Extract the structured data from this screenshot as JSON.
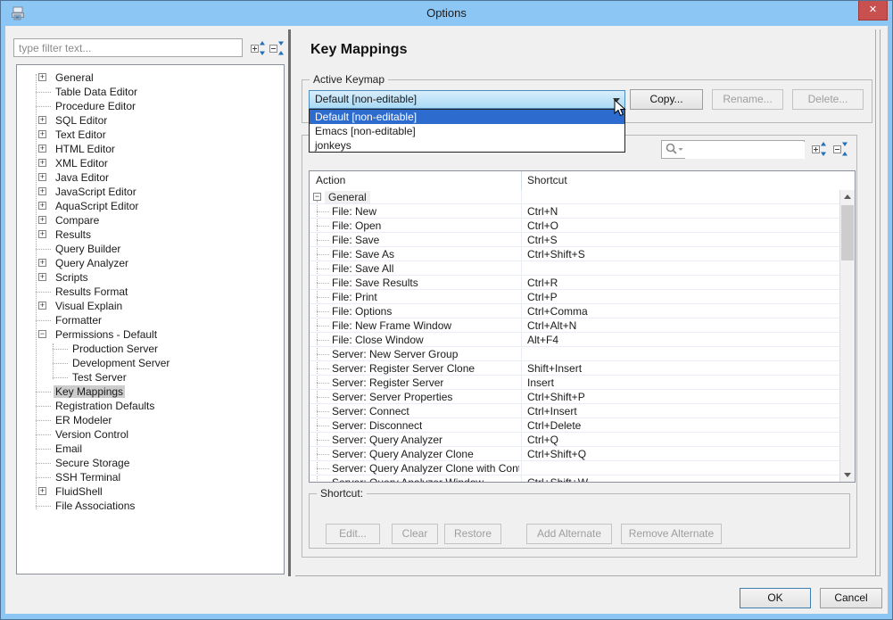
{
  "window": {
    "title": "Options"
  },
  "icons": {
    "close": "✕",
    "expander_collapsed": "+",
    "expander_expanded": "−",
    "search": "magnifier-with-dropdown",
    "expand_all": "plus-box-blue-arrows",
    "collapse_all": "minus-box-blue-arrows"
  },
  "colors": {
    "titlebar": "#8cc6f5",
    "close_button": "#c8504e",
    "selection_blue": "#2d6bcf",
    "combo_focus_top": "#d9eefc",
    "combo_focus_bottom": "#a9d9f5",
    "tree_selection": "#cccccc",
    "panel_bg": "#f0f0f0"
  },
  "left_panel": {
    "filter_placeholder": "type filter text...",
    "tree": [
      {
        "label": "General",
        "expander": "plus",
        "level": 0
      },
      {
        "label": "Table Data Editor",
        "expander": "none",
        "level": 0
      },
      {
        "label": "Procedure Editor",
        "expander": "none",
        "level": 0
      },
      {
        "label": "SQL Editor",
        "expander": "plus",
        "level": 0
      },
      {
        "label": "Text Editor",
        "expander": "plus",
        "level": 0
      },
      {
        "label": "HTML Editor",
        "expander": "plus",
        "level": 0
      },
      {
        "label": "XML Editor",
        "expander": "plus",
        "level": 0
      },
      {
        "label": "Java Editor",
        "expander": "plus",
        "level": 0
      },
      {
        "label": "JavaScript Editor",
        "expander": "plus",
        "level": 0
      },
      {
        "label": "AquaScript Editor",
        "expander": "plus",
        "level": 0
      },
      {
        "label": "Compare",
        "expander": "plus",
        "level": 0
      },
      {
        "label": "Results",
        "expander": "plus",
        "level": 0
      },
      {
        "label": "Query Builder",
        "expander": "none",
        "level": 0
      },
      {
        "label": "Query Analyzer",
        "expander": "plus",
        "level": 0
      },
      {
        "label": "Scripts",
        "expander": "plus",
        "level": 0
      },
      {
        "label": "Results Format",
        "expander": "none",
        "level": 0
      },
      {
        "label": "Visual Explain",
        "expander": "plus",
        "level": 0
      },
      {
        "label": "Formatter",
        "expander": "none",
        "level": 0
      },
      {
        "label": "Permissions - Default",
        "expander": "minus",
        "level": 0
      },
      {
        "label": "Production Server",
        "expander": "none",
        "level": 1
      },
      {
        "label": "Development Server",
        "expander": "none",
        "level": 1
      },
      {
        "label": "Test Server",
        "expander": "none",
        "level": 1
      },
      {
        "label": "Key Mappings",
        "expander": "none",
        "level": 0,
        "selected": true
      },
      {
        "label": "Registration Defaults",
        "expander": "none",
        "level": 0
      },
      {
        "label": "ER Modeler",
        "expander": "none",
        "level": 0
      },
      {
        "label": "Version Control",
        "expander": "none",
        "level": 0
      },
      {
        "label": "Email",
        "expander": "none",
        "level": 0
      },
      {
        "label": "Secure Storage",
        "expander": "none",
        "level": 0
      },
      {
        "label": "SSH Terminal",
        "expander": "none",
        "level": 0
      },
      {
        "label": "FluidShell",
        "expander": "plus",
        "level": 0
      },
      {
        "label": "File Associations",
        "expander": "none",
        "level": 0
      }
    ]
  },
  "right_panel": {
    "title": "Key Mappings",
    "active_keymap": {
      "group_label": "Active Keymap",
      "selected_value": "Default [non-editable]",
      "dropdown_options": [
        {
          "label": "Default [non-editable]",
          "selected": true
        },
        {
          "label": "Emacs [non-editable]",
          "selected": false
        },
        {
          "label": "jonkeys",
          "selected": false
        }
      ],
      "buttons": [
        {
          "label": "Copy...",
          "enabled": true
        },
        {
          "label": "Rename...",
          "enabled": false
        },
        {
          "label": "Delete...",
          "enabled": false
        }
      ]
    },
    "shortcuts": {
      "search_value": "",
      "table": {
        "columns": [
          "Action",
          "Shortcut"
        ],
        "group_row": "General",
        "rows": [
          {
            "action": "File: New",
            "shortcut": "Ctrl+N"
          },
          {
            "action": "File: Open",
            "shortcut": "Ctrl+O"
          },
          {
            "action": "File: Save",
            "shortcut": "Ctrl+S"
          },
          {
            "action": "File: Save As",
            "shortcut": "Ctrl+Shift+S"
          },
          {
            "action": "File: Save All",
            "shortcut": ""
          },
          {
            "action": "File: Save Results",
            "shortcut": "Ctrl+R"
          },
          {
            "action": "File: Print",
            "shortcut": "Ctrl+P"
          },
          {
            "action": "File: Options",
            "shortcut": "Ctrl+Comma"
          },
          {
            "action": "File: New Frame Window",
            "shortcut": "Ctrl+Alt+N"
          },
          {
            "action": "File: Close Window",
            "shortcut": "Alt+F4"
          },
          {
            "action": "Server: New Server Group",
            "shortcut": ""
          },
          {
            "action": "Server: Register Server Clone",
            "shortcut": "Shift+Insert"
          },
          {
            "action": "Server: Register Server",
            "shortcut": "Insert"
          },
          {
            "action": "Server: Server Properties",
            "shortcut": "Ctrl+Shift+P"
          },
          {
            "action": "Server: Connect",
            "shortcut": "Ctrl+Insert"
          },
          {
            "action": "Server: Disconnect",
            "shortcut": "Ctrl+Delete"
          },
          {
            "action": "Server: Query Analyzer",
            "shortcut": "Ctrl+Q"
          },
          {
            "action": "Server: Query Analyzer Clone",
            "shortcut": "Ctrl+Shift+Q"
          },
          {
            "action": "Server: Query Analyzer Clone with Content",
            "shortcut": ""
          },
          {
            "action": "Server: Query Analyzer Window",
            "shortcut": "Ctrl+Shift+W"
          }
        ]
      },
      "shortcut_group": {
        "label": "Shortcut:",
        "buttons": [
          {
            "label": "Edit...",
            "enabled": false
          },
          {
            "label": "Clear",
            "enabled": false
          },
          {
            "label": "Restore",
            "enabled": false
          },
          {
            "label": "Add Alternate",
            "enabled": false
          },
          {
            "label": "Remove Alternate",
            "enabled": false
          }
        ]
      }
    }
  },
  "footer": {
    "ok": "OK",
    "cancel": "Cancel"
  }
}
